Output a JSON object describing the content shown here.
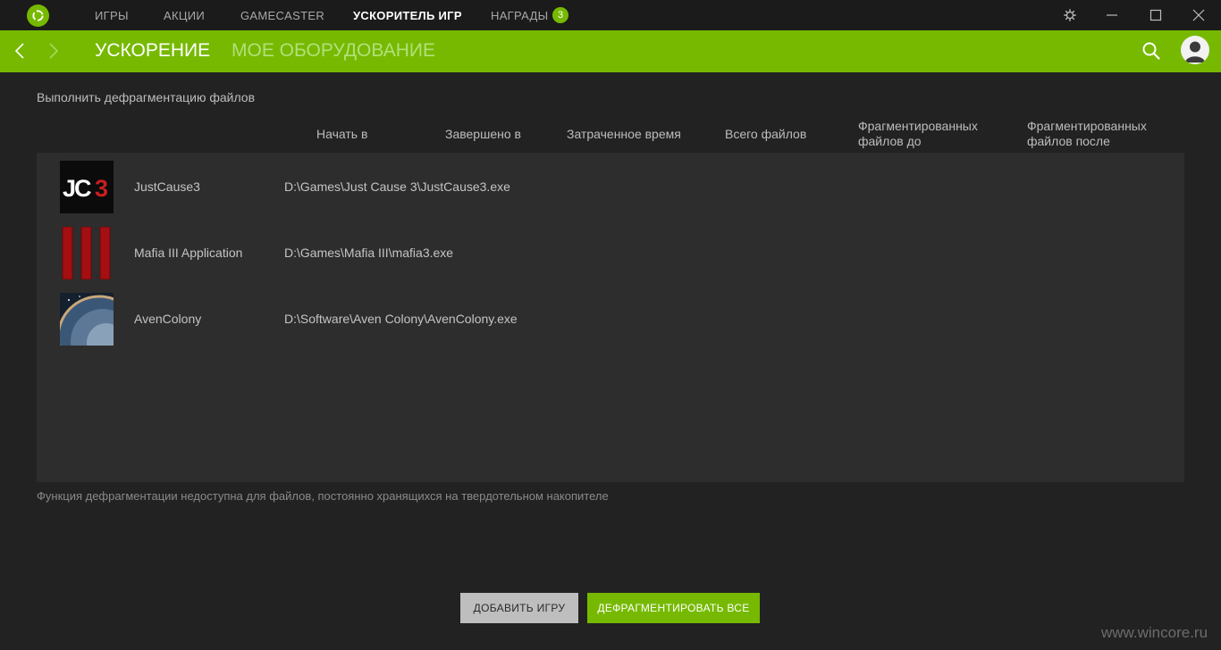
{
  "titlebar": {
    "tabs": [
      {
        "label": "ИГРЫ"
      },
      {
        "label": "АКЦИИ"
      },
      {
        "label": "GAMECASTER"
      },
      {
        "label": "УСКОРИТЕЛЬ ИГР",
        "active": true
      },
      {
        "label": "НАГРАДЫ"
      }
    ],
    "rewards_badge": "3",
    "icons": [
      "nvidia-logo-icon",
      "settings-icon",
      "minimize-icon",
      "maximize-icon",
      "close-icon"
    ]
  },
  "subnav": {
    "tabs": [
      {
        "label": "УСКОРЕНИЕ",
        "active": true
      },
      {
        "label": "МОЕ ОБОРУДОВАНИЕ"
      }
    ],
    "icons": [
      "back-arrow-icon",
      "forward-arrow-icon",
      "search-icon",
      "avatar-icon"
    ]
  },
  "main": {
    "section_title": "Выполнить дефрагментацию файлов",
    "columns": {
      "start": "Начать в",
      "finished": "Завершено в",
      "elapsed": "Затраченное время",
      "total": "Всего файлов",
      "frag_before_1": "Фрагментированных",
      "frag_before_2": "файлов до",
      "frag_after_1": "Фрагментированных",
      "frag_after_2": "файлов после"
    },
    "games": [
      {
        "name": "JustCause3",
        "path": "D:\\Games\\Just Cause 3\\JustCause3.exe",
        "icon_text": "JC3"
      },
      {
        "name": "Mafia III Application",
        "path": "D:\\Games\\Mafia III\\mafia3.exe"
      },
      {
        "name": "AvenColony",
        "path": "D:\\Software\\Aven Colony\\AvenColony.exe"
      }
    ],
    "footnote": "Функция дефрагментации недоступна для файлов, постоянно хранящихся на твердотельном накопителе"
  },
  "buttons": {
    "add_game": "ДОБАВИТЬ ИГРУ",
    "defrag_all": "ДЕФРАГМЕНТИРОВАТЬ ВСЕ"
  },
  "watermark": "www.wincore.ru",
  "colors": {
    "accent": "#76b900",
    "background": "#222222",
    "titlebar": "#1b1b1b",
    "panel": "#2d2d2d"
  }
}
